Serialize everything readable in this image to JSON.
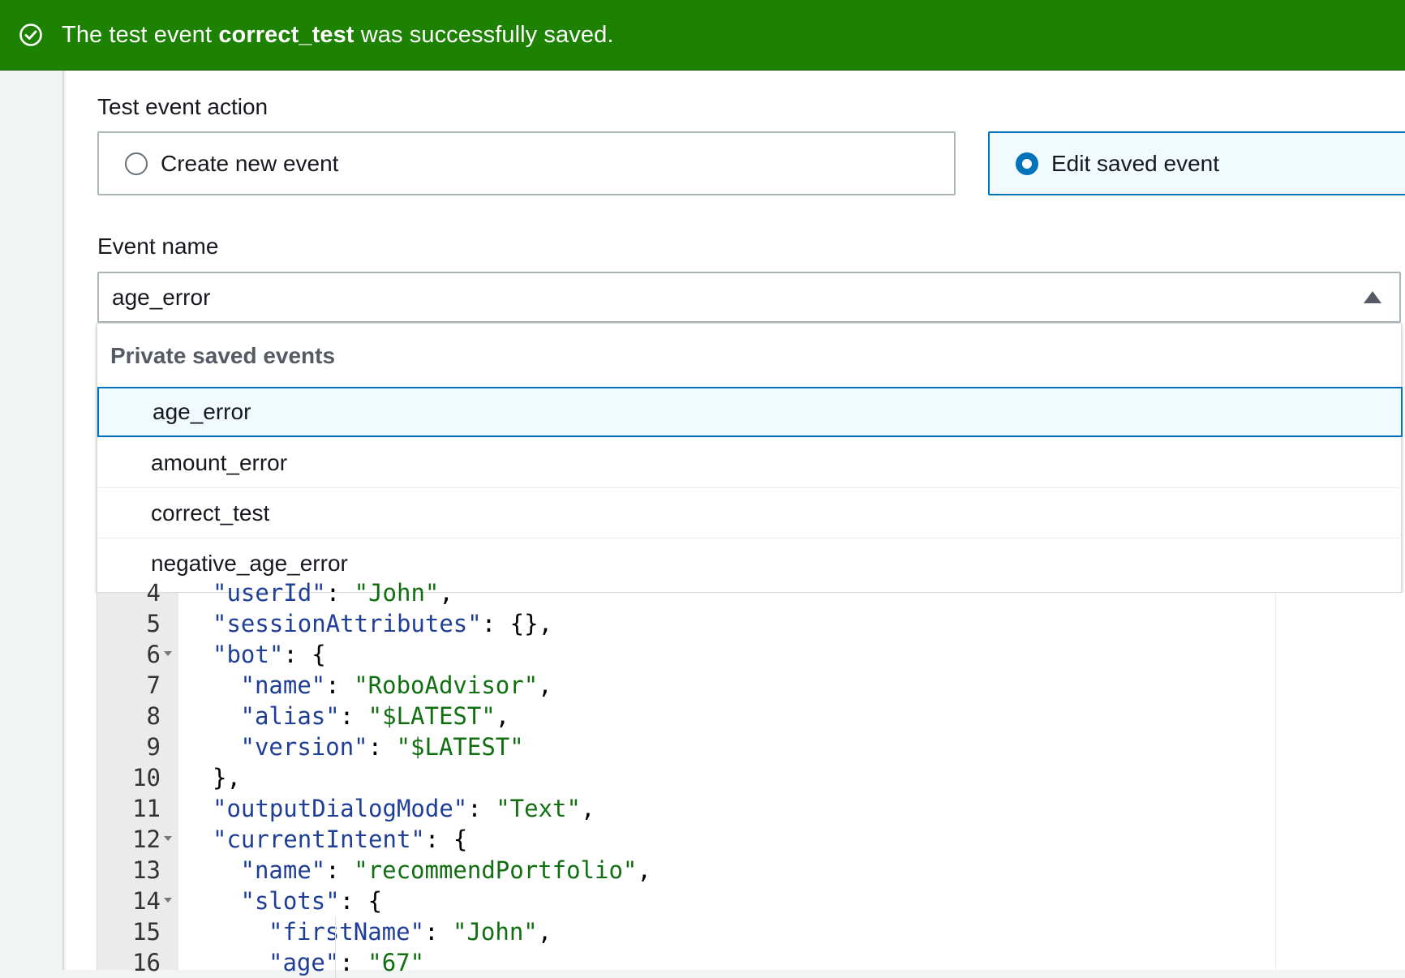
{
  "flash": {
    "prefix": "The test event ",
    "event_name": "correct_test",
    "suffix": " was successfully saved.",
    "color": "#1d8102",
    "icon": "check-circle-icon"
  },
  "action": {
    "label": "Test event action",
    "create_label": "Create new event",
    "edit_label": "Edit saved event",
    "selected": "edit"
  },
  "event_name": {
    "label": "Event name",
    "value": "age_error",
    "group_label": "Private saved events",
    "options": [
      "age_error",
      "amount_error",
      "correct_test",
      "negative_age_error"
    ]
  },
  "editor": {
    "lines": [
      {
        "n": "4",
        "fold": false,
        "key": "\"userId\"",
        "sep": ": ",
        "val": "\"John\"",
        "end": ",",
        "indent": 1
      },
      {
        "n": "5",
        "fold": false,
        "key": "\"sessionAttributes\"",
        "sep": ": ",
        "val": "",
        "end": "{},",
        "indent": 1
      },
      {
        "n": "6",
        "fold": true,
        "key": "\"bot\"",
        "sep": ": ",
        "val": "",
        "end": "{",
        "indent": 1
      },
      {
        "n": "7",
        "fold": false,
        "key": "\"name\"",
        "sep": ": ",
        "val": "\"RoboAdvisor\"",
        "end": ",",
        "indent": 2
      },
      {
        "n": "8",
        "fold": false,
        "key": "\"alias\"",
        "sep": ": ",
        "val": "\"$LATEST\"",
        "end": ",",
        "indent": 2
      },
      {
        "n": "9",
        "fold": false,
        "key": "\"version\"",
        "sep": ": ",
        "val": "\"$LATEST\"",
        "end": "",
        "indent": 2
      },
      {
        "n": "10",
        "fold": false,
        "key": "",
        "sep": "",
        "val": "",
        "end": "},",
        "indent": 1
      },
      {
        "n": "11",
        "fold": false,
        "key": "\"outputDialogMode\"",
        "sep": ": ",
        "val": "\"Text\"",
        "end": ",",
        "indent": 1
      },
      {
        "n": "12",
        "fold": true,
        "key": "\"currentIntent\"",
        "sep": ": ",
        "val": "",
        "end": "{",
        "indent": 1
      },
      {
        "n": "13",
        "fold": false,
        "key": "\"name\"",
        "sep": ": ",
        "val": "\"recommendPortfolio\"",
        "end": ",",
        "indent": 2
      },
      {
        "n": "14",
        "fold": true,
        "key": "\"slots\"",
        "sep": ": ",
        "val": "",
        "end": "{",
        "indent": 2
      },
      {
        "n": "15",
        "fold": false,
        "key": "\"firstName\"",
        "sep": ": ",
        "val": "\"John\"",
        "end": ",",
        "indent": 3
      },
      {
        "n": "16",
        "fold": false,
        "key": "\"age\"",
        "sep": ": ",
        "val": "\"67\"",
        "end": "",
        "indent": 3
      }
    ]
  }
}
